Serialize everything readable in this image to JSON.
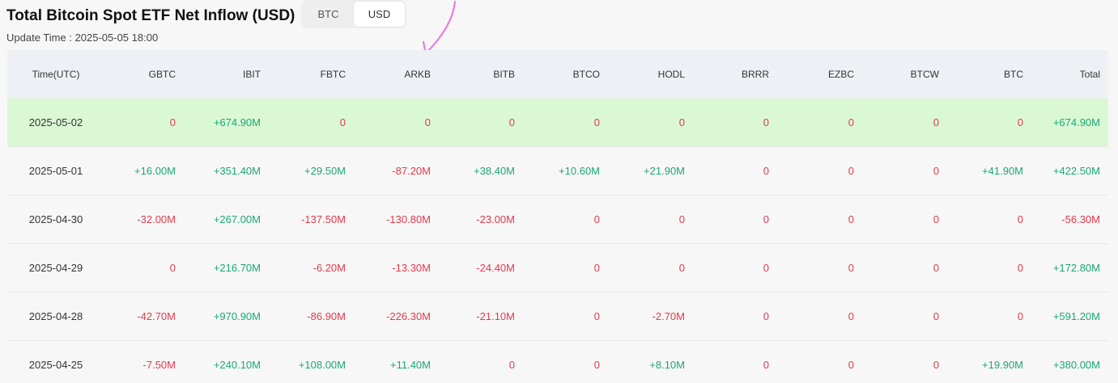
{
  "header": {
    "title": "Total Bitcoin Spot ETF Net Inflow (USD)",
    "update_time": "Update Time : 2025-05-05 18:00",
    "toggle": {
      "options": [
        "BTC",
        "USD"
      ],
      "selected": "USD"
    }
  },
  "colors": {
    "positive": "#1aa876",
    "negative": "#e5394b",
    "highlight_row": "#dbf8d4",
    "header_bg": "#edf1f5",
    "annotation": "#f07ae0"
  },
  "table": {
    "columns": [
      "Time(UTC)",
      "GBTC",
      "IBIT",
      "FBTC",
      "ARKB",
      "BITB",
      "BTCO",
      "HODL",
      "BRRR",
      "EZBC",
      "BTCW",
      "BTC",
      "Total"
    ],
    "rows": [
      [
        "2025-05-02",
        "0",
        "+674.90M",
        "0",
        "0",
        "0",
        "0",
        "0",
        "0",
        "0",
        "0",
        "0",
        "+674.90M"
      ],
      [
        "2025-05-01",
        "+16.00M",
        "+351.40M",
        "+29.50M",
        "-87.20M",
        "+38.40M",
        "+10.60M",
        "+21.90M",
        "0",
        "0",
        "0",
        "+41.90M",
        "+422.50M"
      ],
      [
        "2025-04-30",
        "-32.00M",
        "+267.00M",
        "-137.50M",
        "-130.80M",
        "-23.00M",
        "0",
        "0",
        "0",
        "0",
        "0",
        "0",
        "-56.30M"
      ],
      [
        "2025-04-29",
        "0",
        "+216.70M",
        "-6.20M",
        "-13.30M",
        "-24.40M",
        "0",
        "0",
        "0",
        "0",
        "0",
        "0",
        "+172.80M"
      ],
      [
        "2025-04-28",
        "-42.70M",
        "+970.90M",
        "-86.90M",
        "-226.30M",
        "-21.10M",
        "0",
        "-2.70M",
        "0",
        "0",
        "0",
        "0",
        "+591.20M"
      ],
      [
        "2025-04-25",
        "-7.50M",
        "+240.10M",
        "+108.00M",
        "+11.40M",
        "0",
        "0",
        "+8.10M",
        "0",
        "0",
        "0",
        "+19.90M",
        "+380.00M"
      ]
    ],
    "highlighted_row_index": 0
  },
  "annotation": {
    "icon": "arrow-icon"
  }
}
